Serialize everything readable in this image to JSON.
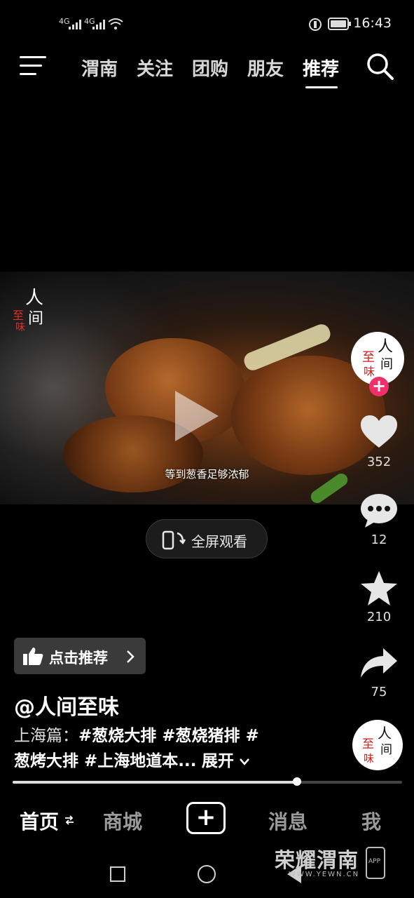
{
  "status_bar": {
    "signal1": "4G",
    "signal2": "4G",
    "time": "16:43"
  },
  "top_nav": {
    "tabs": [
      "渭南",
      "关注",
      "团购",
      "朋友",
      "推荐"
    ],
    "active": "推荐"
  },
  "video": {
    "subtitle": "等到葱香足够浓郁",
    "watermark": "人间至味"
  },
  "fullscreen_label": "全屏观看",
  "actions": {
    "likes": "352",
    "comments": "12",
    "favorites": "210",
    "shares": "75"
  },
  "recommend_label": "点击推荐",
  "author": "@人间至味",
  "description": {
    "prefix": "上海篇：",
    "line1_tags": "#葱烧大排 #葱烧猪排 #",
    "line2_tags": "葱烤大排 #上海地道本...",
    "expand": "展开"
  },
  "progress": 0.73,
  "bottom_tabs": {
    "home": "首页",
    "mall": "商城",
    "add": "+",
    "messages": "消息",
    "me": "我"
  },
  "watermark_brand": {
    "name": "荣耀渭南",
    "url": "WWW.YEWN.CN",
    "app": "APP"
  },
  "colors": {
    "follow_badge": "#f0306a",
    "background": "#000000"
  }
}
